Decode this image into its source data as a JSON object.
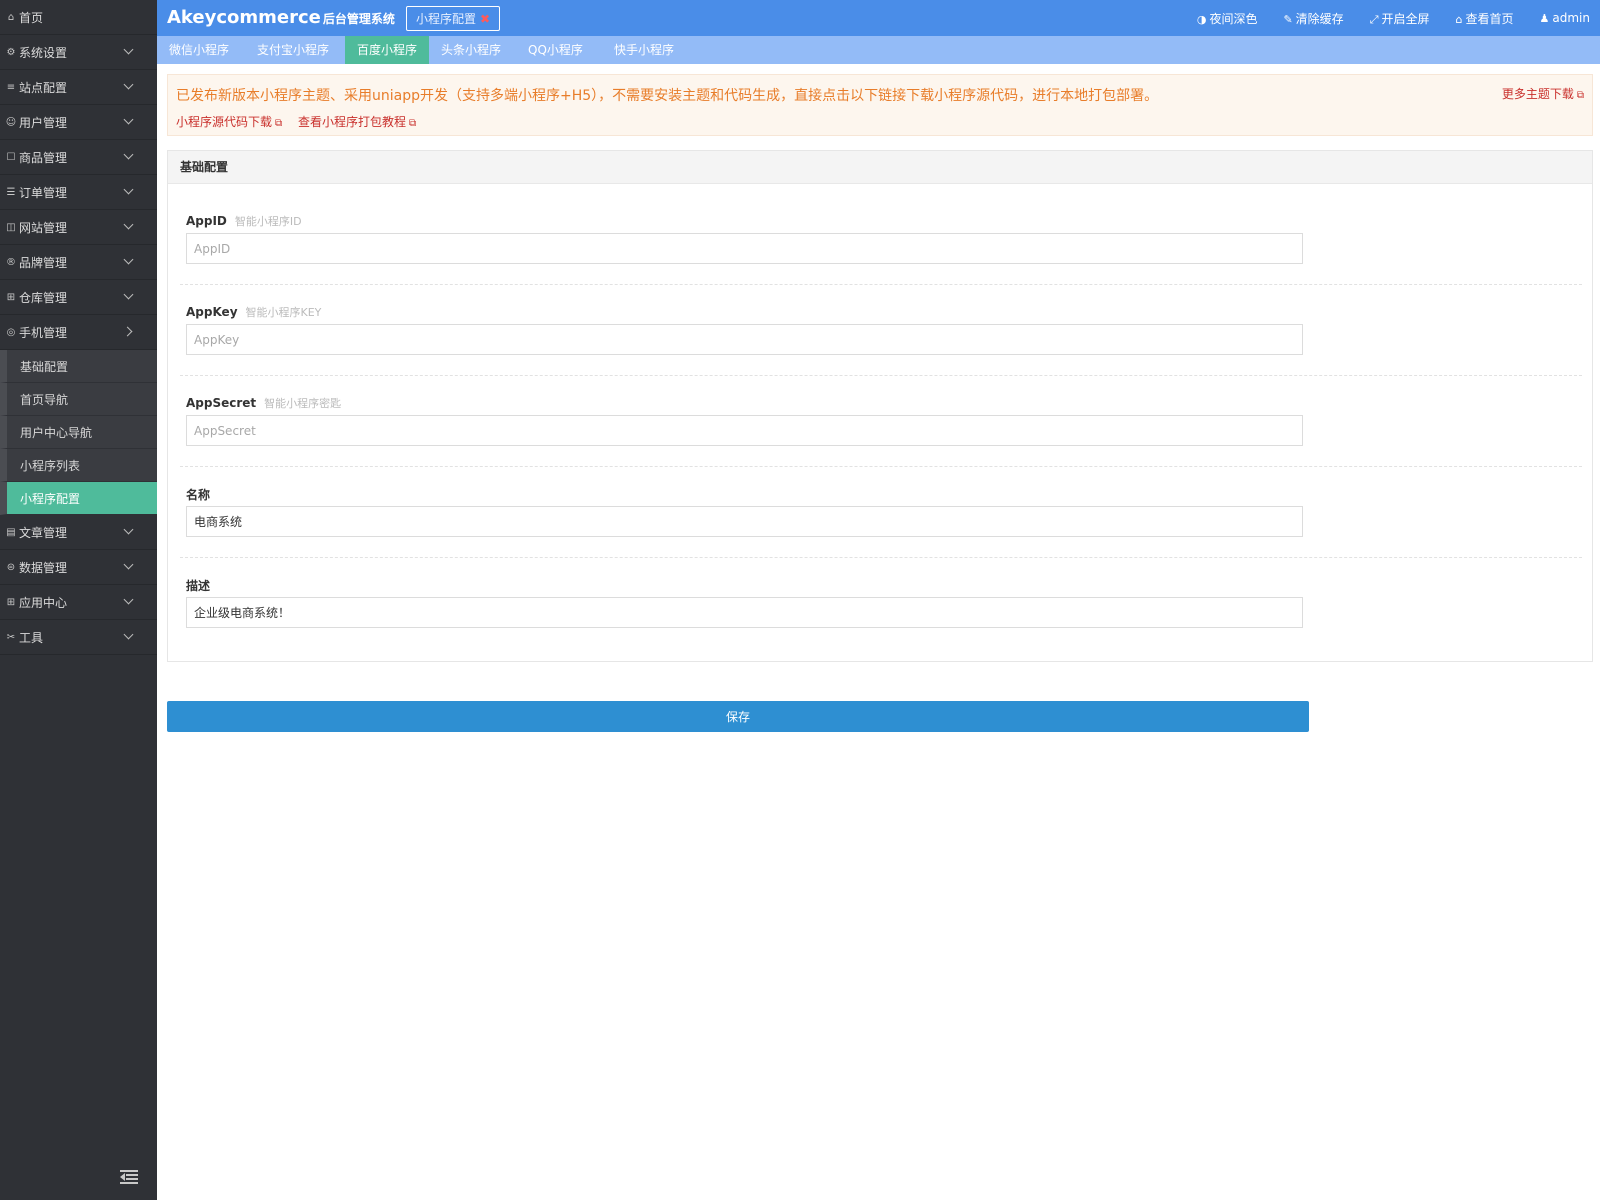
{
  "sidebar": {
    "items": [
      {
        "icon": "home-icon",
        "glyph": "⌂",
        "label": "首页"
      },
      {
        "icon": "gear-icon",
        "glyph": "⚙",
        "label": "系统设置"
      },
      {
        "icon": "sliders-icon",
        "glyph": "≡",
        "label": "站点配置"
      },
      {
        "icon": "user-icon",
        "glyph": "☺",
        "label": "用户管理"
      },
      {
        "icon": "bag-icon",
        "glyph": "☐",
        "label": "商品管理"
      },
      {
        "icon": "list-icon",
        "glyph": "☰",
        "label": "订单管理"
      },
      {
        "icon": "site-icon",
        "glyph": "◫",
        "label": "网站管理"
      },
      {
        "icon": "registered-icon",
        "glyph": "®",
        "label": "品牌管理"
      },
      {
        "icon": "warehouse-icon",
        "glyph": "⊞",
        "label": "仓库管理"
      },
      {
        "icon": "mobile-icon",
        "glyph": "◎",
        "label": "手机管理"
      }
    ],
    "sub_items": [
      {
        "label": "基础配置"
      },
      {
        "label": "首页导航"
      },
      {
        "label": "用户中心导航"
      },
      {
        "label": "小程序列表"
      },
      {
        "label": "小程序配置",
        "active": true
      }
    ],
    "items_after": [
      {
        "icon": "article-icon",
        "glyph": "▤",
        "label": "文章管理"
      },
      {
        "icon": "database-icon",
        "glyph": "⊜",
        "label": "数据管理"
      },
      {
        "icon": "apps-icon",
        "glyph": "⊞",
        "label": "应用中心"
      },
      {
        "icon": "tools-icon",
        "glyph": "✂",
        "label": "工具"
      }
    ],
    "collapse_icon": "menu-collapse-icon"
  },
  "header": {
    "brand": "Akeycommerce",
    "brand_sub": "后台管理系统",
    "open_tab": "小程序配置",
    "links": [
      {
        "icon": "contrast-icon",
        "glyph": "◑",
        "label": "夜间深色"
      },
      {
        "icon": "brush-icon",
        "glyph": "✎",
        "label": "清除缓存"
      },
      {
        "icon": "fullscreen-icon",
        "glyph": "⤢",
        "label": "开启全屏"
      },
      {
        "icon": "home-icon",
        "glyph": "⌂",
        "label": "查看首页"
      },
      {
        "icon": "user-icon",
        "glyph": "♟",
        "label": "admin"
      }
    ],
    "color": "#4a8de8"
  },
  "subnav": {
    "tabs": [
      "微信小程序",
      "支付宝小程序",
      "百度小程序",
      "头条小程序",
      "QQ小程序",
      "快手小程序"
    ],
    "active_index": 2
  },
  "notice": {
    "message": "已发布新版本小程序主题、采用uniapp开发（支持多端小程序+H5），不需要安装主题和代码生成，直接点击以下链接下载小程序源代码，进行本地打包部署。",
    "more": "更多主题下载",
    "link1": "小程序源代码下载",
    "link2": "查看小程序打包教程"
  },
  "panel": {
    "title": "基础配置",
    "fields": [
      {
        "label": "AppID",
        "hint": "智能小程序ID",
        "value": "",
        "placeholder": "AppID"
      },
      {
        "label": "AppKey",
        "hint": "智能小程序KEY",
        "value": "",
        "placeholder": "AppKey"
      },
      {
        "label": "AppSecret",
        "hint": "智能小程序密匙",
        "value": "",
        "placeholder": "AppSecret"
      },
      {
        "label": "名称",
        "hint": "",
        "value": "电商系统",
        "placeholder": ""
      },
      {
        "label": "描述",
        "hint": "",
        "value": "企业级电商系统！",
        "placeholder": ""
      }
    ]
  },
  "save_label": "保存",
  "colors": {
    "accent_green": "#4fbb9b",
    "save_blue": "#2e8fd2",
    "notice_orange": "#e87d2a",
    "link_red": "#c9302c"
  }
}
